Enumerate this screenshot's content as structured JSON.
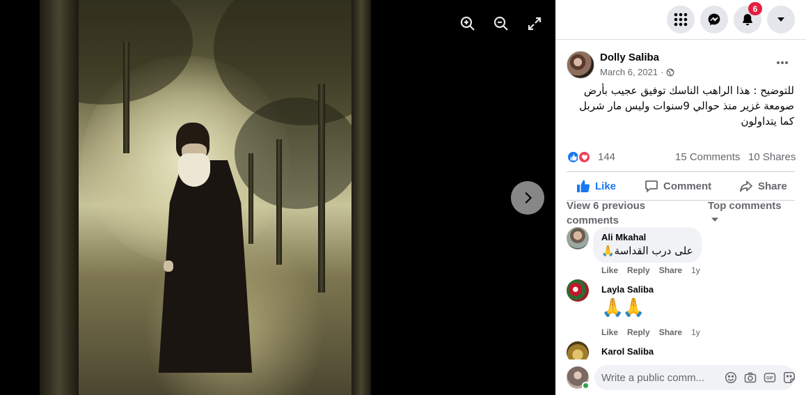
{
  "viewer": {
    "photo_alt": "Black-and-white photo of a bearded monk in a dark robe walking on a forest path",
    "zoom_in_icon": "zoom-in-icon",
    "zoom_out_icon": "zoom-out-icon",
    "fullscreen_icon": "fullscreen-icon",
    "next_icon": "chevron-right-icon"
  },
  "topbar": {
    "menu_icon": "grid-menu-icon",
    "messenger_icon": "messenger-icon",
    "notifications_icon": "bell-icon",
    "notifications_count": "6",
    "account_icon": "caret-down-icon"
  },
  "post": {
    "author": "Dolly Saliba",
    "date": "March 6, 2021",
    "date_separator": "·",
    "audience_icon": "globe-icon",
    "more_icon": "more-horizontal-icon",
    "text_lines": [
      "للتوضيح : هذا الراهب الناسك توفيق عجيب بأرض",
      "صومعة غزير منذ حوالي 9سنوات وليس مار شربل",
      "كما يتداولون"
    ],
    "reaction_count": "144",
    "comments_count": "15 Comments",
    "shares_count": "10 Shares"
  },
  "actions": {
    "like": "Like",
    "comment": "Comment",
    "share": "Share"
  },
  "comments_section": {
    "view_previous": "View 6 previous comments",
    "sort_label": "Top comments"
  },
  "comments": [
    {
      "name": "Ali Mkahal",
      "text": "على درب القداسة🙏",
      "like": "Like",
      "reply": "Reply",
      "share": "Share",
      "time": "1y"
    },
    {
      "name": "Layla Saliba",
      "text": "🙏🙏",
      "like": "Like",
      "reply": "Reply",
      "share": "Share",
      "time": "1y"
    },
    {
      "name": "Karol Saliba"
    }
  ],
  "composer": {
    "placeholder": "Write a public comm...",
    "emoji_icon": "emoji-icon",
    "camera_icon": "camera-icon",
    "gif_icon": "gif-icon",
    "sticker_icon": "sticker-icon"
  },
  "colors": {
    "accent": "#1877f2",
    "badge": "#e41e3f",
    "love": "#f33e58",
    "online": "#31a24c"
  }
}
